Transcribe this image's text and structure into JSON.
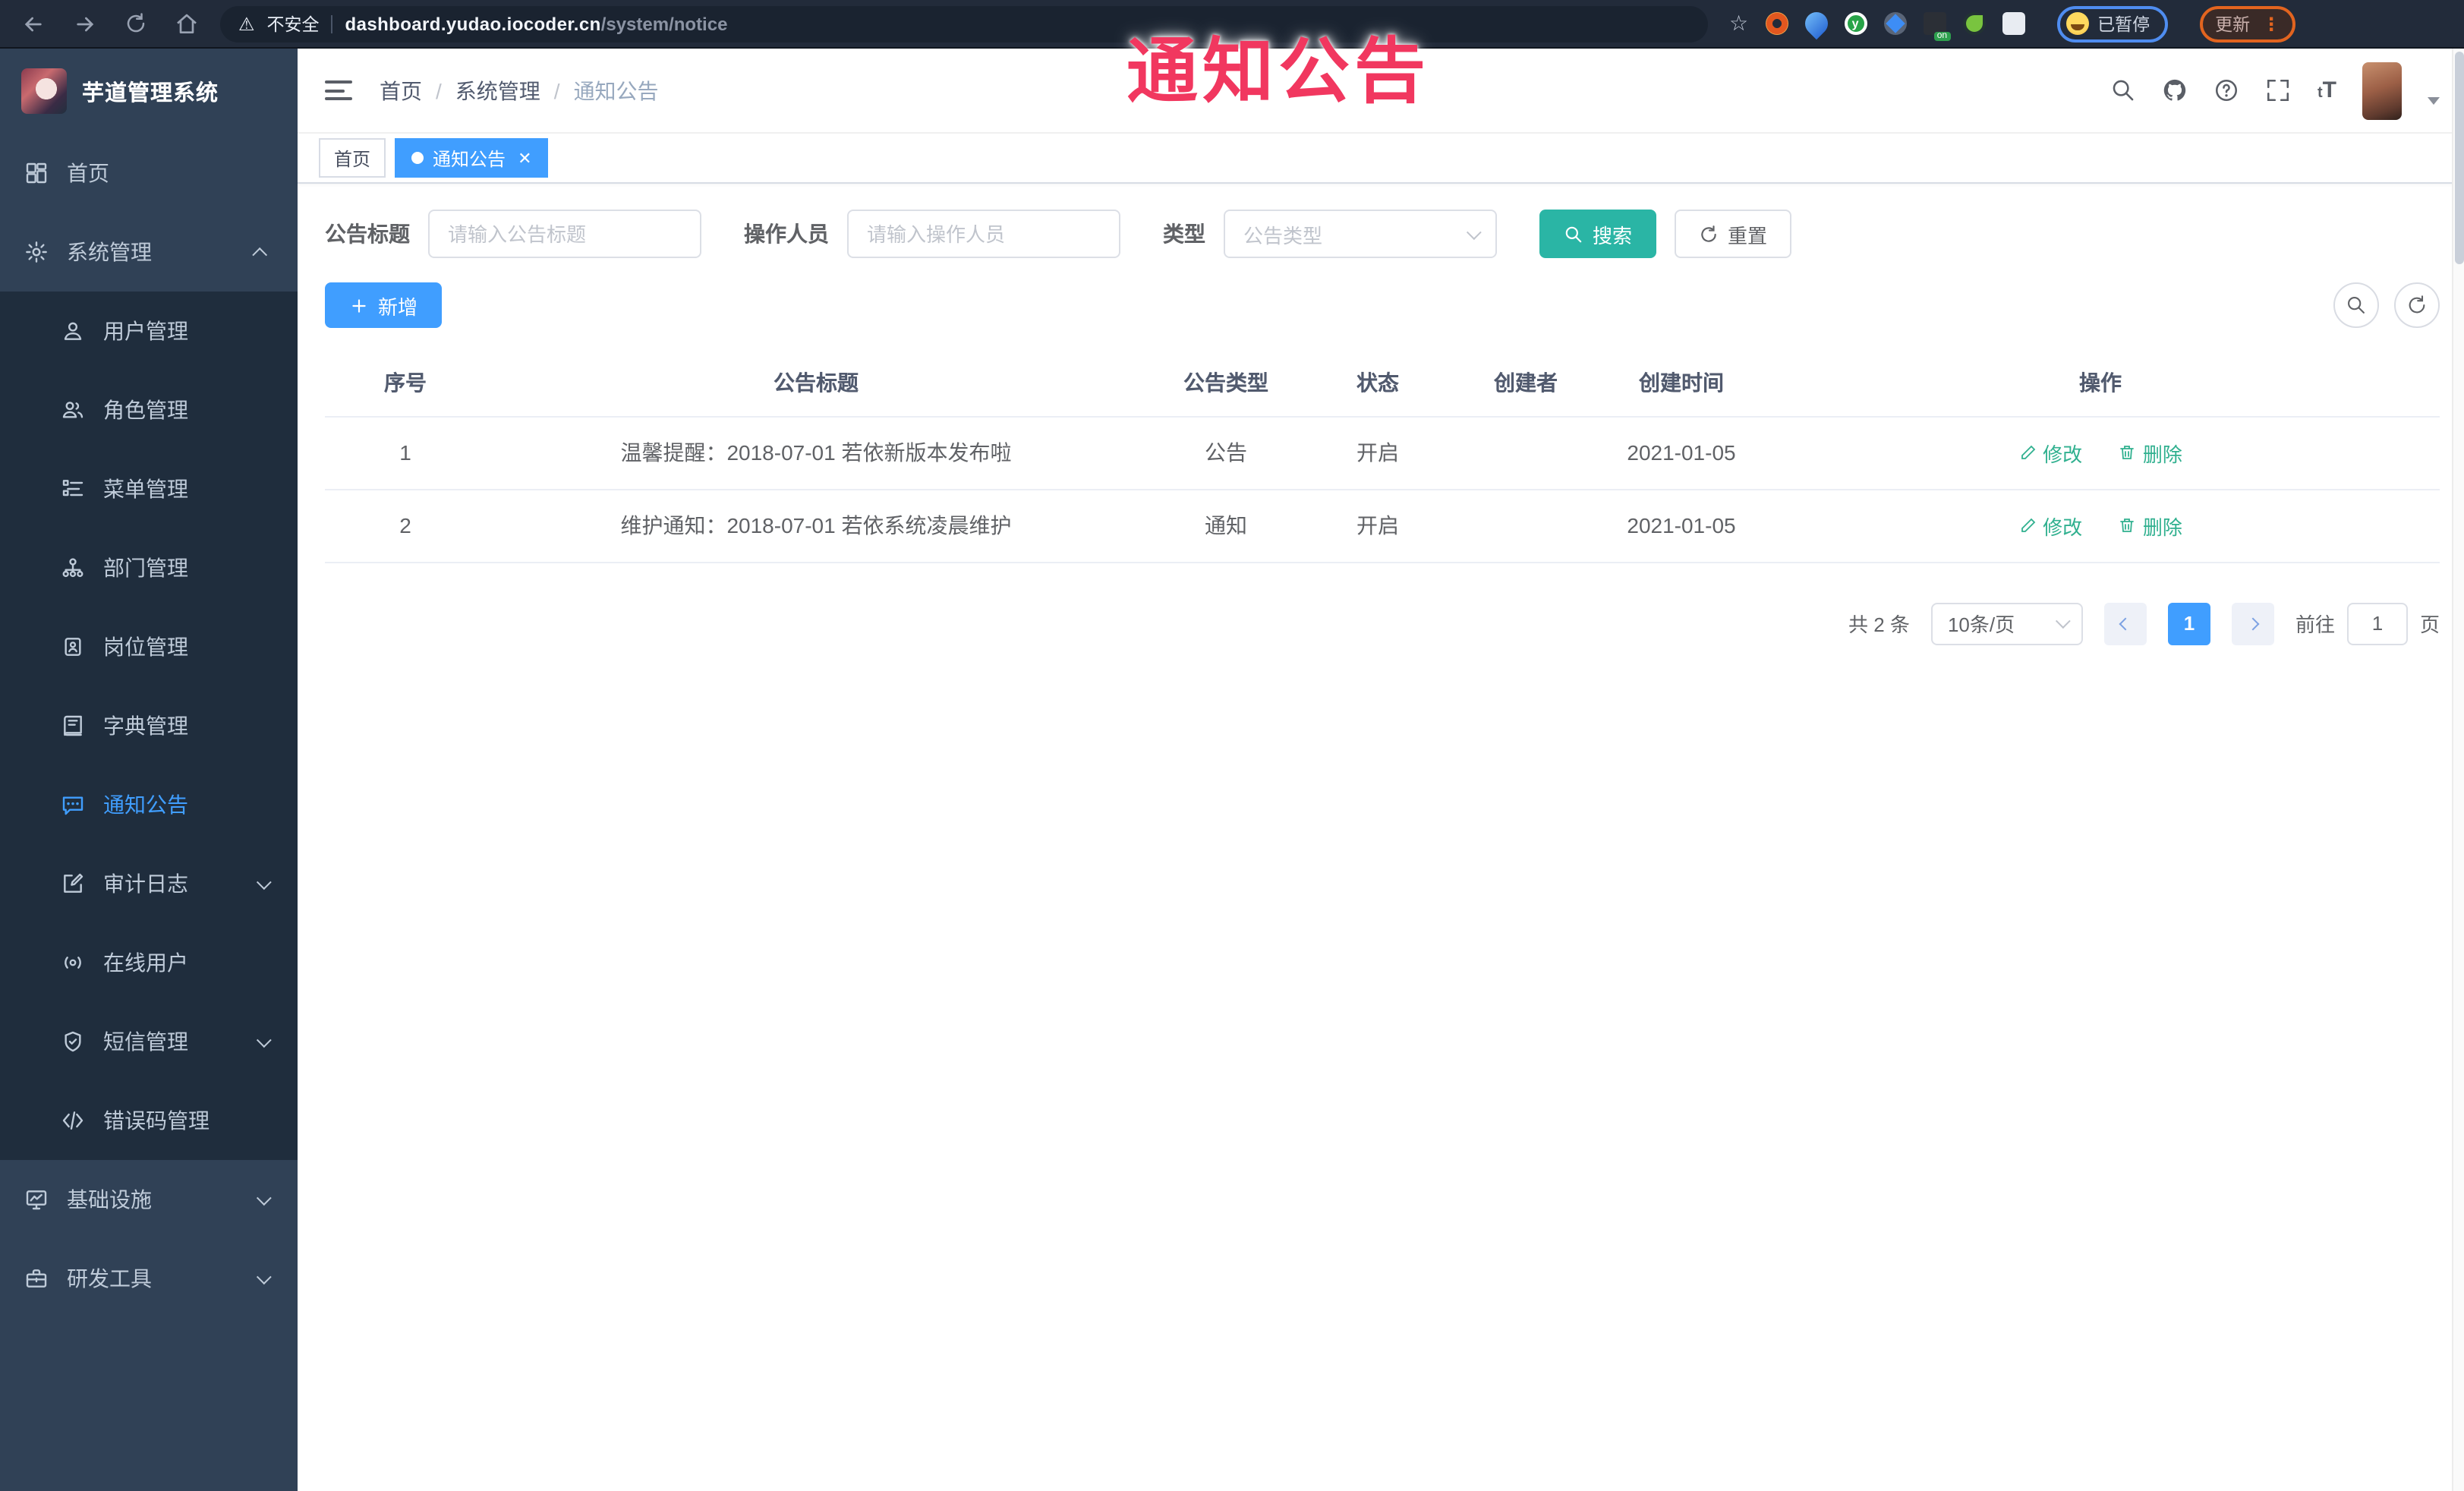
{
  "annotation": {
    "text": "通知公告",
    "color": "#f1375f"
  },
  "browser": {
    "security_label": "不安全",
    "url_host": "dashboard.yudao.iocoder.cn",
    "url_path": "/system/notice",
    "extension_badge": "on",
    "profile_status": "已暂停",
    "update_label": "更新"
  },
  "sidebar": {
    "title": "芋道管理系统",
    "home_label": "首页",
    "system_label": "系统管理",
    "submenu": [
      {
        "label": "用户管理"
      },
      {
        "label": "角色管理"
      },
      {
        "label": "菜单管理"
      },
      {
        "label": "部门管理"
      },
      {
        "label": "岗位管理"
      },
      {
        "label": "字典管理"
      },
      {
        "label": "通知公告"
      },
      {
        "label": "审计日志"
      },
      {
        "label": "在线用户"
      },
      {
        "label": "短信管理"
      },
      {
        "label": "错误码管理"
      }
    ],
    "infra_label": "基础设施",
    "devtools_label": "研发工具"
  },
  "header": {
    "breadcrumb": {
      "0": "首页",
      "1": "系统管理",
      "2": "通知公告"
    }
  },
  "tags": {
    "home": "首页",
    "active_tab": "通知公告"
  },
  "filters": {
    "title_label": "公告标题",
    "title_placeholder": "请输入公告标题",
    "operator_label": "操作人员",
    "operator_placeholder": "请输入操作人员",
    "type_label": "类型",
    "type_placeholder": "公告类型",
    "search_label": "搜索",
    "reset_label": "重置"
  },
  "toolbar": {
    "add_label": "新增"
  },
  "table": {
    "columns": {
      "no": "序号",
      "title": "公告标题",
      "type": "公告类型",
      "status": "状态",
      "creator": "创建者",
      "create_time": "创建时间",
      "actions": "操作"
    },
    "rows": [
      {
        "no": "1",
        "title": "温馨提醒：2018-07-01 若依新版本发布啦",
        "type": "公告",
        "status": "开启",
        "creator": "",
        "create_time": "2021-01-05"
      },
      {
        "no": "2",
        "title": "维护通知：2018-07-01 若依系统凌晨维护",
        "type": "通知",
        "status": "开启",
        "creator": "",
        "create_time": "2021-01-05"
      }
    ],
    "edit_label": "修改",
    "delete_label": "删除"
  },
  "pagination": {
    "total_text": "共 2 条",
    "page_size": "10条/页",
    "current_page": "1",
    "goto_label": "前往",
    "goto_value": "1",
    "page_suffix": "页"
  },
  "colors": {
    "accent_blue": "#409eff",
    "search_teal": "#2ab5a5",
    "action_green": "#30b08f",
    "sidebar_bg": "#304156",
    "submenu_bg": "#1f2d3d",
    "annotation_red": "#f1375f"
  },
  "icons": {
    "browser": [
      "back",
      "forward",
      "reload",
      "home",
      "warning-triangle",
      "bookmark-star",
      "extensions",
      "profile-emoji",
      "menu-dots"
    ],
    "header": [
      "search",
      "github",
      "help",
      "fullscreen",
      "font-size",
      "caret-down"
    ],
    "table_actions": [
      "edit-pencil",
      "trash"
    ]
  }
}
